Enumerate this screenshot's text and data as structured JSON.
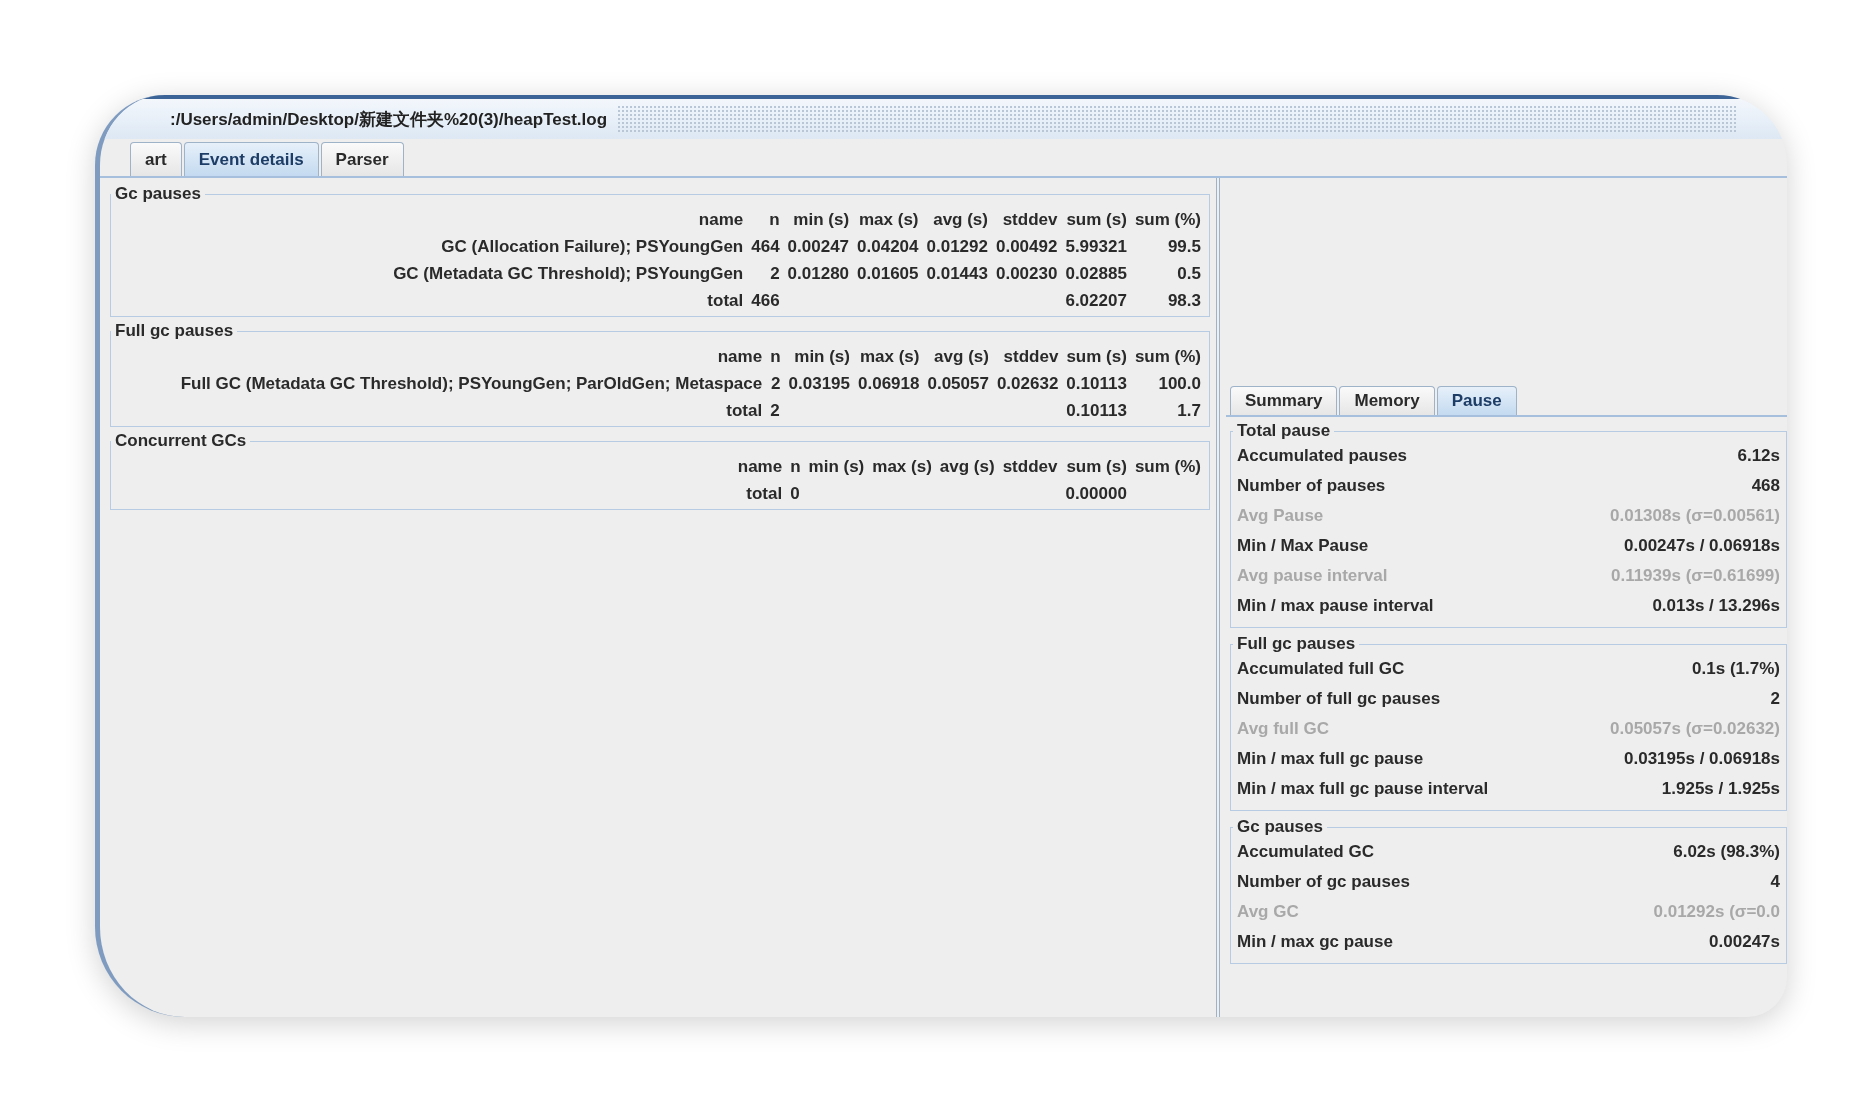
{
  "window": {
    "title": ":/Users/admin/Desktop/新建文件夹%20(3)/heapTest.log"
  },
  "tabs": [
    {
      "label": "art",
      "selected": false
    },
    {
      "label": "Event details",
      "selected": true
    },
    {
      "label": "Parser",
      "selected": false
    }
  ],
  "event_details": [
    {
      "title": "Gc pauses",
      "columns": [
        "name",
        "n",
        "min (s)",
        "max (s)",
        "avg (s)",
        "stddev",
        "sum (s)",
        "sum (%)"
      ],
      "rows": [
        [
          "GC (Allocation Failure); PSYoungGen",
          "464",
          "0.00247",
          "0.04204",
          "0.01292",
          "0.00492",
          "5.99321",
          "99.5"
        ],
        [
          "GC (Metadata GC Threshold); PSYoungGen",
          "2",
          "0.01280",
          "0.01605",
          "0.01443",
          "0.00230",
          "0.02885",
          "0.5"
        ]
      ],
      "total": {
        "label": "total",
        "n": "466",
        "sum_s": "6.02207",
        "sum_pct": "98.3"
      }
    },
    {
      "title": "Full gc pauses",
      "columns": [
        "name",
        "n",
        "min (s)",
        "max (s)",
        "avg (s)",
        "stddev",
        "sum (s)",
        "sum (%)"
      ],
      "rows": [
        [
          "Full GC (Metadata GC Threshold); PSYoungGen; ParOldGen; Metaspace",
          "2",
          "0.03195",
          "0.06918",
          "0.05057",
          "0.02632",
          "0.10113",
          "100.0"
        ]
      ],
      "total": {
        "label": "total",
        "n": "2",
        "sum_s": "0.10113",
        "sum_pct": "1.7"
      }
    },
    {
      "title": "Concurrent GCs",
      "columns": [
        "name",
        "n",
        "min (s)",
        "max (s)",
        "avg (s)",
        "stddev",
        "sum (s)",
        "sum (%)"
      ],
      "total": {
        "label": "total",
        "n": "0",
        "sum_s": "0.00000"
      }
    }
  ],
  "summary_panel": {
    "tabs": [
      {
        "label": "Summary",
        "selected": false
      },
      {
        "label": "Memory",
        "selected": false
      },
      {
        "label": "Pause",
        "selected": true
      }
    ],
    "groups": [
      {
        "title": "Total pause",
        "rows": [
          {
            "label": "Accumulated pauses",
            "value": "6.12s",
            "dimmed": false
          },
          {
            "label": "Number of pauses",
            "value": "468",
            "dimmed": false
          },
          {
            "label": "Avg Pause",
            "value": "0.01308s (σ=0.00561)",
            "dimmed": true
          },
          {
            "label": "Min / Max Pause",
            "value": "0.00247s / 0.06918s",
            "dimmed": false
          },
          {
            "label": "Avg pause interval",
            "value": "0.11939s (σ=0.61699)",
            "dimmed": true
          },
          {
            "label": "Min / max pause interval",
            "value": "0.013s / 13.296s",
            "dimmed": false
          }
        ]
      },
      {
        "title": "Full gc pauses",
        "rows": [
          {
            "label": "Accumulated full GC",
            "value": "0.1s (1.7%)",
            "dimmed": false
          },
          {
            "label": "Number of full gc pauses",
            "value": "2",
            "dimmed": false
          },
          {
            "label": "Avg full GC",
            "value": "0.05057s (σ=0.02632)",
            "dimmed": true
          },
          {
            "label": "Min / max full gc pause",
            "value": "0.03195s / 0.06918s",
            "dimmed": false
          },
          {
            "label": "Min / max full gc pause interval",
            "value": "1.925s / 1.925s",
            "dimmed": false
          }
        ]
      },
      {
        "title": "Gc pauses",
        "rows": [
          {
            "label": "Accumulated GC",
            "value": "6.02s (98.3%)",
            "dimmed": false
          },
          {
            "label": "Number of gc pauses",
            "value": "4",
            "dimmed": false
          },
          {
            "label": "Avg GC",
            "value": "0.01292s (σ=0.0",
            "dimmed": true
          },
          {
            "label": "Min / max gc pause",
            "value": "0.00247s",
            "dimmed": false
          }
        ]
      }
    ]
  }
}
